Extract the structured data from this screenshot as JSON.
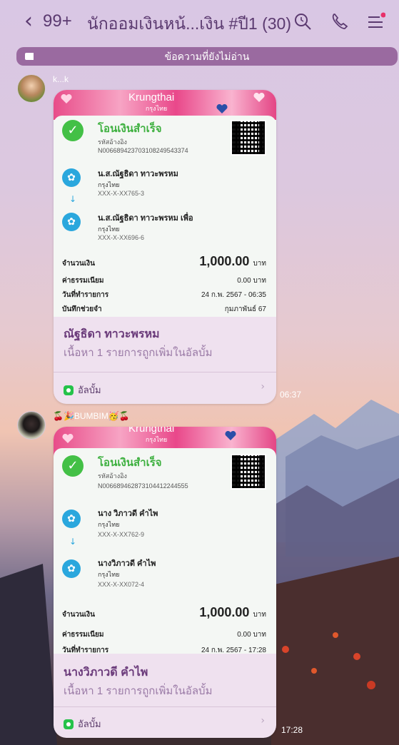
{
  "header": {
    "back_symbol": "<",
    "unread_count": "99+",
    "chat_title": "นักออมเงินหน้...เงิน #ปี1 (30)",
    "search_icon": "search-icon",
    "call_icon": "phone-icon",
    "menu_icon": "menu-icon",
    "notification_color": "#e8306a"
  },
  "unread_bar": {
    "label": "ข้อความที่ยังไม่อ่าน"
  },
  "messages": [
    {
      "sender": "k...k",
      "slip": {
        "bank_name": "Krungthai",
        "bank_name_th": "กรุงไทย",
        "status": "โอนเงินสำเร็จ",
        "ref_label": "รหัสอ้างอิง",
        "ref_number": "N006689423703108249543374",
        "from_name": "น.ส.ณัฐธิดา ทาวะพรหม",
        "from_bank": "กรุงไทย",
        "from_account": "XXX-X-XX765-3",
        "to_name": "น.ส.ณัฐธิดา ทาวะพรหม เพื่อ",
        "to_bank": "กรุงไทย",
        "to_account": "XXX-X-XX696-6",
        "amount_label": "จำนวนเงิน",
        "amount": "1,000.00",
        "amount_unit": "บาท",
        "fee_label": "ค่าธรรมเนียม",
        "fee": "0.00 บาท",
        "date_label": "วันที่ทำรายการ",
        "date": "24 ก.พ. 2567 - 06:35",
        "memo_label": "บันทึกช่วยจำ",
        "memo": "กุมภาพันธ์ 67"
      },
      "album_title": "ณัฐธิดา ทาวะพรหม",
      "album_sub": "เนื้อหา 1 รายการถูกเพิ่มในอัลบั้ม",
      "album_link": "อัลบั้ม",
      "time": "06:37"
    },
    {
      "sender": "🍒🎉BUMBIM🥳🍒",
      "slip": {
        "bank_name": "Krungthai",
        "bank_name_th": "กรุงไทย",
        "status": "โอนเงินสำเร็จ",
        "ref_label": "รหัสอ้างอิง",
        "ref_number": "N006689462873104412244555",
        "from_name": "นาง วิภาวดี คำไพ",
        "from_bank": "กรุงไทย",
        "from_account": "XXX-X-XX762-9",
        "to_name": "นางวิภาวดี คำไพ",
        "to_bank": "กรุงไทย",
        "to_account": "XXX-X-XX072-4",
        "amount_label": "จำนวนเงิน",
        "amount": "1,000.00",
        "amount_unit": "บาท",
        "fee_label": "ค่าธรรมเนียม",
        "fee": "0.00 บาท",
        "date_label": "วันที่ทำรายการ",
        "date": "24 ก.พ. 2567 - 17:28"
      },
      "album_title": "นางวิภาวดี คำไพ",
      "album_sub": "เนื้อหา 1 รายการถูกเพิ่มในอัลบั้ม",
      "album_link": "อัลบั้ม",
      "time": "17:28"
    }
  ]
}
